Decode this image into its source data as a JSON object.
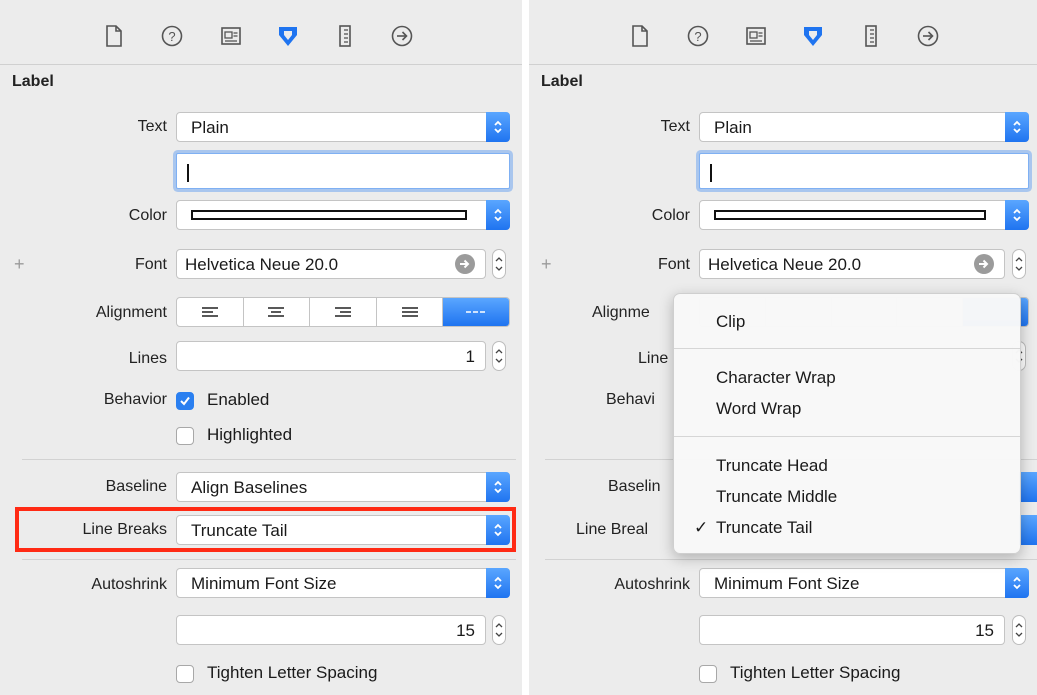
{
  "colors": {
    "accent": "#2a7ff0",
    "highlight_border": "#ff2a14",
    "panel_bg": "#ececec"
  },
  "toolbar": {
    "icons": [
      "file-inspector-icon",
      "help-icon",
      "identity-inspector-icon",
      "attributes-inspector-icon",
      "size-inspector-icon",
      "connections-inspector-icon"
    ]
  },
  "left": {
    "section_title": "Label",
    "text_label": "Text",
    "text_value": "Plain",
    "color_label": "Color",
    "font_label": "Font",
    "font_value": "Helvetica Neue 20.0",
    "alignment_label": "Alignment",
    "lines_label": "Lines",
    "lines_value": "1",
    "behavior_label": "Behavior",
    "enabled_label": "Enabled",
    "highlighted_label": "Highlighted",
    "baseline_label": "Baseline",
    "baseline_value": "Align Baselines",
    "line_breaks_label": "Line Breaks",
    "line_breaks_value": "Truncate Tail",
    "autoshrink_label": "Autoshrink",
    "autoshrink_value": "Minimum Font Size",
    "min_font_value": "15",
    "tighten_label": "Tighten Letter Spacing"
  },
  "right": {
    "section_title": "Label",
    "text_label": "Text",
    "text_value": "Plain",
    "color_label": "Color",
    "font_label": "Font",
    "font_value": "Helvetica Neue 20.0",
    "alignment_label_partial": "Alignme",
    "lines_label_partial": "Line",
    "behavior_label_partial": "Behavi",
    "baseline_label_partial": "Baselin",
    "line_breaks_label_partial": "Line Breal",
    "autoshrink_label": "Autoshrink",
    "autoshrink_value": "Minimum Font Size",
    "min_font_value": "15",
    "tighten_label": "Tighten Letter Spacing",
    "menu": {
      "items": [
        "Clip",
        "Character Wrap",
        "Word Wrap",
        "Truncate Head",
        "Truncate Middle",
        "Truncate Tail"
      ],
      "selected": "Truncate Tail",
      "check_glyph": "✓"
    }
  }
}
